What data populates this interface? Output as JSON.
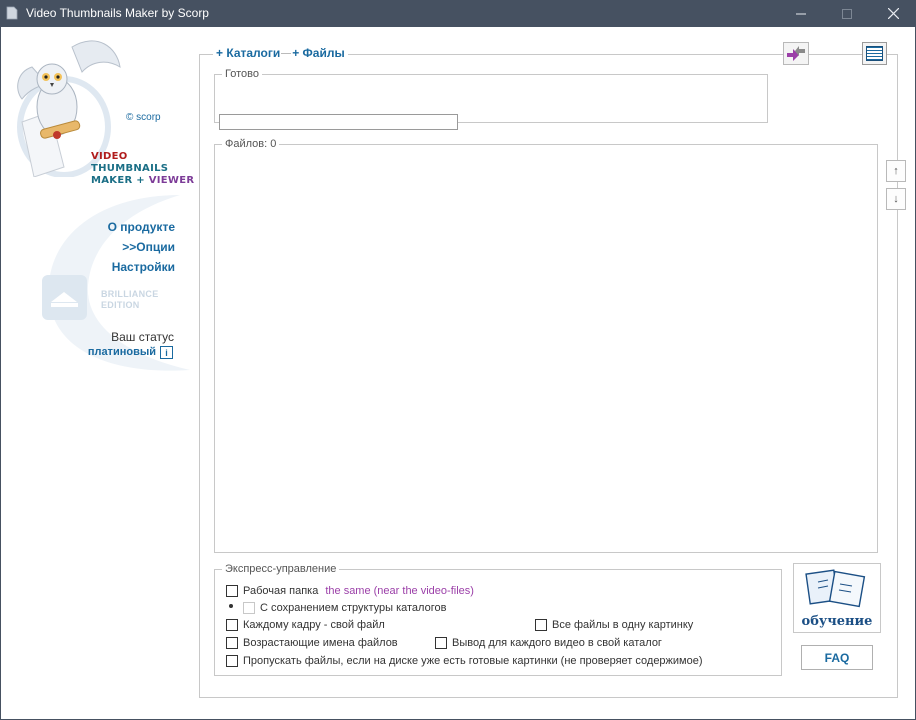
{
  "window": {
    "title": "Video Thumbnails Maker by Scorp",
    "minimize_icon": "minimize-icon",
    "maximize_icon": "maximize-icon",
    "close_icon": "close-icon"
  },
  "sidebar": {
    "copyright": "© scorp",
    "brand": {
      "line1": "VIDEO",
      "line2": "THUMBNAILS",
      "line3_a": "MAKER",
      "line3_plus": " + ",
      "line3_b": "VIEWER"
    },
    "nav": {
      "about": "О продукте",
      "options": ">>Опции",
      "settings": "Настройки"
    },
    "edition": {
      "line1": "BRILLIANCE",
      "line2": "EDITION"
    },
    "status_label": "Ваш статус",
    "status_value": "платиновый",
    "info_glyph": "i"
  },
  "main": {
    "tabs": {
      "catalogs": "+ Каталоги",
      "files": "+ Файлы"
    },
    "ready_legend": "Готово",
    "progress_fraction": 0,
    "files_legend": "Файлов: 0",
    "side_up": "↑",
    "side_down": "↓"
  },
  "express": {
    "legend": "Экспресс-управление",
    "options": {
      "work_folder_label": "Рабочая папка",
      "work_folder_value": "the same (near the video-files)",
      "keep_structure": "С сохранением структуры каталогов",
      "each_frame": "Каждому кадру - свой файл",
      "all_in_one": "Все файлы в одну картинку",
      "ascending_names": "Возрастающие имена файлов",
      "each_video_dir": "Вывод для каждого видео в свой каталог",
      "skip_existing": "Пропускать файлы, если на диске уже есть готовые картинки (не проверяет содержимое)"
    }
  },
  "buttons": {
    "training": "обучение",
    "faq": "FAQ"
  },
  "colors": {
    "titlebar": "#465161",
    "link": "#1a6aa0",
    "accent_purple": "#9b3fa8"
  }
}
